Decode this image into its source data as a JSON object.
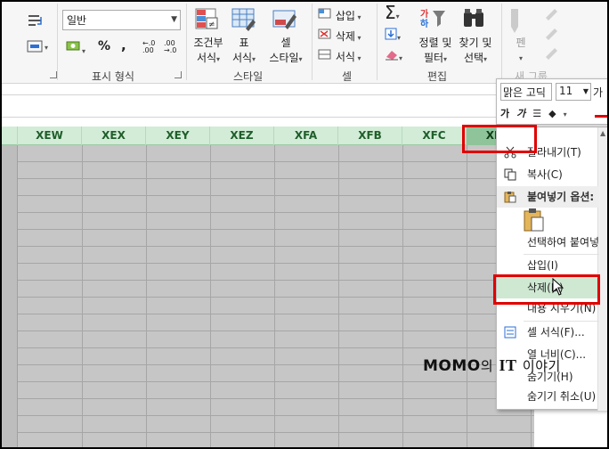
{
  "ribbon": {
    "number_format_value": "일반",
    "currency_label": "$",
    "percent_label": "%",
    "comma_label": ",",
    "increase_decimal_label": "←.0 .00",
    "decrease_decimal_label": ".00 →.0",
    "number_group_label": "표시 형식",
    "conditional_format_line1": "조건부",
    "conditional_format_line2": "서식",
    "format_as_table_line1": "표",
    "format_as_table_line2": "서식",
    "cell_styles_line1": "셀",
    "cell_styles_line2": "스타일",
    "styles_group_label": "스타일",
    "insert_label": "삽입",
    "delete_label": "삭제",
    "format_label": "서식",
    "cells_group_label": "셀",
    "sort_filter_line1": "정렬 및",
    "sort_filter_line2": "필터",
    "find_select_line1": "찾기 및",
    "find_select_line2": "선택",
    "editing_group_label": "편집",
    "pen_label": "펜",
    "ink_group_label": "새 그룹"
  },
  "columns": [
    "XEW",
    "XEX",
    "XEY",
    "XEZ",
    "XFA",
    "XFB",
    "XFC",
    "XFD"
  ],
  "selected_column": "XFD",
  "mini_toolbar": {
    "font_name": "맑은 고딕",
    "font_size": "11",
    "grow_font_label": "가",
    "bold_label": "가",
    "italic_label": "가"
  },
  "context_menu": {
    "cut": "잘라내기(T)",
    "copy": "복사(C)",
    "paste_options_header": "붙여넣기 옵션:",
    "paste_special": "선택하여 붙여넣기...",
    "insert": "삽입(I)",
    "delete": "삭제(D)",
    "clear_contents": "내용 지우기(N)",
    "format_cells": "셀 서식(F)...",
    "column_width": "열 너비(C)...",
    "hide": "숨기기(H)",
    "unhide": "숨기기 취소(U)"
  },
  "watermark": {
    "brand": "MOMO",
    "particle": "의",
    "it": "IT",
    "story": "이야기"
  },
  "colors": {
    "header_green": "#d2ecd7",
    "selected_header": "#8fc49a",
    "highlight_red": "#e00000",
    "grid_gray": "#c6c6c6",
    "menu_hover": "#cfe8d2"
  }
}
